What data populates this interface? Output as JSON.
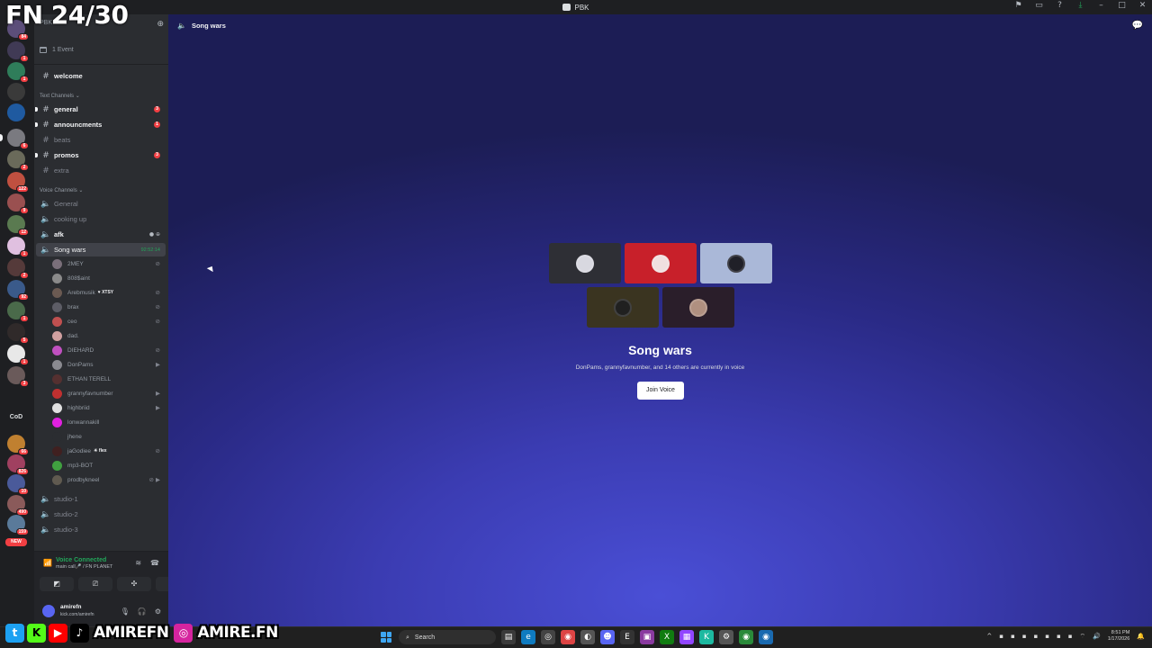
{
  "overlay": {
    "fn_counter": "FN 24/30"
  },
  "window": {
    "title": "PBK",
    "icons": [
      "inbox-flag-icon",
      "inbox-icon",
      "help-icon",
      "download-icon",
      "minimize-icon",
      "maximize-icon",
      "close-icon"
    ]
  },
  "servers": {
    "badges": [
      "84",
      "1",
      "1",
      "6",
      "2",
      "122",
      "9",
      "12",
      "1",
      "2",
      "92",
      "1",
      "5",
      "1",
      "3",
      "66",
      "826",
      "10",
      "490",
      "159"
    ],
    "text_label": "CoD",
    "new_label": "NEW"
  },
  "guild": {
    "name": "PBK",
    "events": "1 Event"
  },
  "channels": {
    "welcome": "welcome",
    "text_category": "Text Channels",
    "general": "general",
    "general_mentions": "3",
    "announcments": "announcments",
    "announcments_mentions": "1",
    "beats": "beats",
    "promos": "promos",
    "promos_mentions": "3",
    "extra": "extra",
    "voice_category": "Voice Channels",
    "voice_general": "General",
    "cooking_up": "cooking up",
    "afk": "afk",
    "song_wars": "Song wars",
    "song_wars_timer": "92:52:14",
    "studio_1": "studio-1",
    "studio_2": "studio-2",
    "studio_3": "studio-3"
  },
  "members": [
    {
      "name": "2MEY",
      "tag": "",
      "color": "#7a6f7a",
      "icon": "deafened-icon"
    },
    {
      "name": "808$aint",
      "tag": "",
      "color": "#8a8a8a",
      "icon": ""
    },
    {
      "name": "Arebmusik",
      "tag": "♥ XTSY",
      "color": "#6b5a52",
      "icon": "deafened-icon"
    },
    {
      "name": "brax",
      "tag": "",
      "color": "#5d5d66",
      "icon": "deafened-icon"
    },
    {
      "name": "ceo",
      "tag": "",
      "color": "#c05050",
      "icon": "deafened-icon"
    },
    {
      "name": "dad.",
      "tag": "",
      "color": "#d0a0a0",
      "icon": ""
    },
    {
      "name": "DIEHARD",
      "tag": "",
      "color": "#c050c0",
      "icon": "deafened-icon"
    },
    {
      "name": "DonPams",
      "tag": "",
      "color": "#8a8a90",
      "icon": "video-icon"
    },
    {
      "name": "ETHAN TERELL",
      "tag": "",
      "color": "#553030",
      "icon": ""
    },
    {
      "name": "grannyfavnumber",
      "tag": "",
      "color": "#c03030",
      "icon": "video-icon"
    },
    {
      "name": "highbriid",
      "tag": "",
      "color": "#e0e0e0",
      "icon": "video-icon"
    },
    {
      "name": "lonwannakill",
      "tag": "",
      "color": "#e020e0",
      "icon": ""
    },
    {
      "name": "jhene",
      "tag": "",
      "color": "#2b2d31",
      "icon": ""
    },
    {
      "name": "jaGodiee",
      "tag": "☀ flex",
      "color": "#402020",
      "icon": "deafened-icon"
    },
    {
      "name": "mp3-BOT",
      "tag": "",
      "color": "#40a040",
      "icon": ""
    },
    {
      "name": "prodbykneel",
      "tag": "",
      "color": "#605a50",
      "icon": "deafened-video-icon"
    }
  ],
  "voice_panel": {
    "status": "Voice Connected",
    "location": "main call🎤 / FN PLANET"
  },
  "user": {
    "name": "amirefn",
    "subtitle": "kick.com/amirefn"
  },
  "main": {
    "header_title": "Song wars",
    "tiles": [
      {
        "bg": "#2e2f35",
        "avatar": "#d8d8e0"
      },
      {
        "bg": "#c8202a",
        "avatar": "#f0e0e0"
      },
      {
        "bg": "#aab8d8",
        "avatar": "#202028"
      },
      {
        "bg": "#3a3420",
        "avatar": "#202020"
      },
      {
        "bg": "#2a1e2a",
        "avatar": "#b09080"
      }
    ],
    "channel_title": "Song wars",
    "description": "DonPams, grannyfavnumber, and 14 others are currently in voice",
    "join_button": "Join Voice"
  },
  "taskbar": {
    "search_placeholder": "Search",
    "time": "8:51 PM",
    "date": "1/17/2026"
  },
  "social": {
    "handle_1": "AMIREFN",
    "handle_2": "AMIRE.FN"
  }
}
